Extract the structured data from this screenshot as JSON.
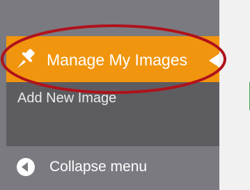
{
  "sidebar": {
    "active_item": {
      "label": "Manage My Images",
      "icon": "pin-icon"
    },
    "submenu": [
      {
        "label": "Add New Image"
      }
    ],
    "collapse": {
      "label": "Collapse menu",
      "icon": "collapse-arrow-icon"
    }
  },
  "colors": {
    "sidebar_bg": "#7b7a80",
    "active_bg": "#f1950e",
    "submenu_bg": "#5d5c61",
    "highlight_ring": "#b0121b",
    "content_bg": "#f1f1f1"
  }
}
